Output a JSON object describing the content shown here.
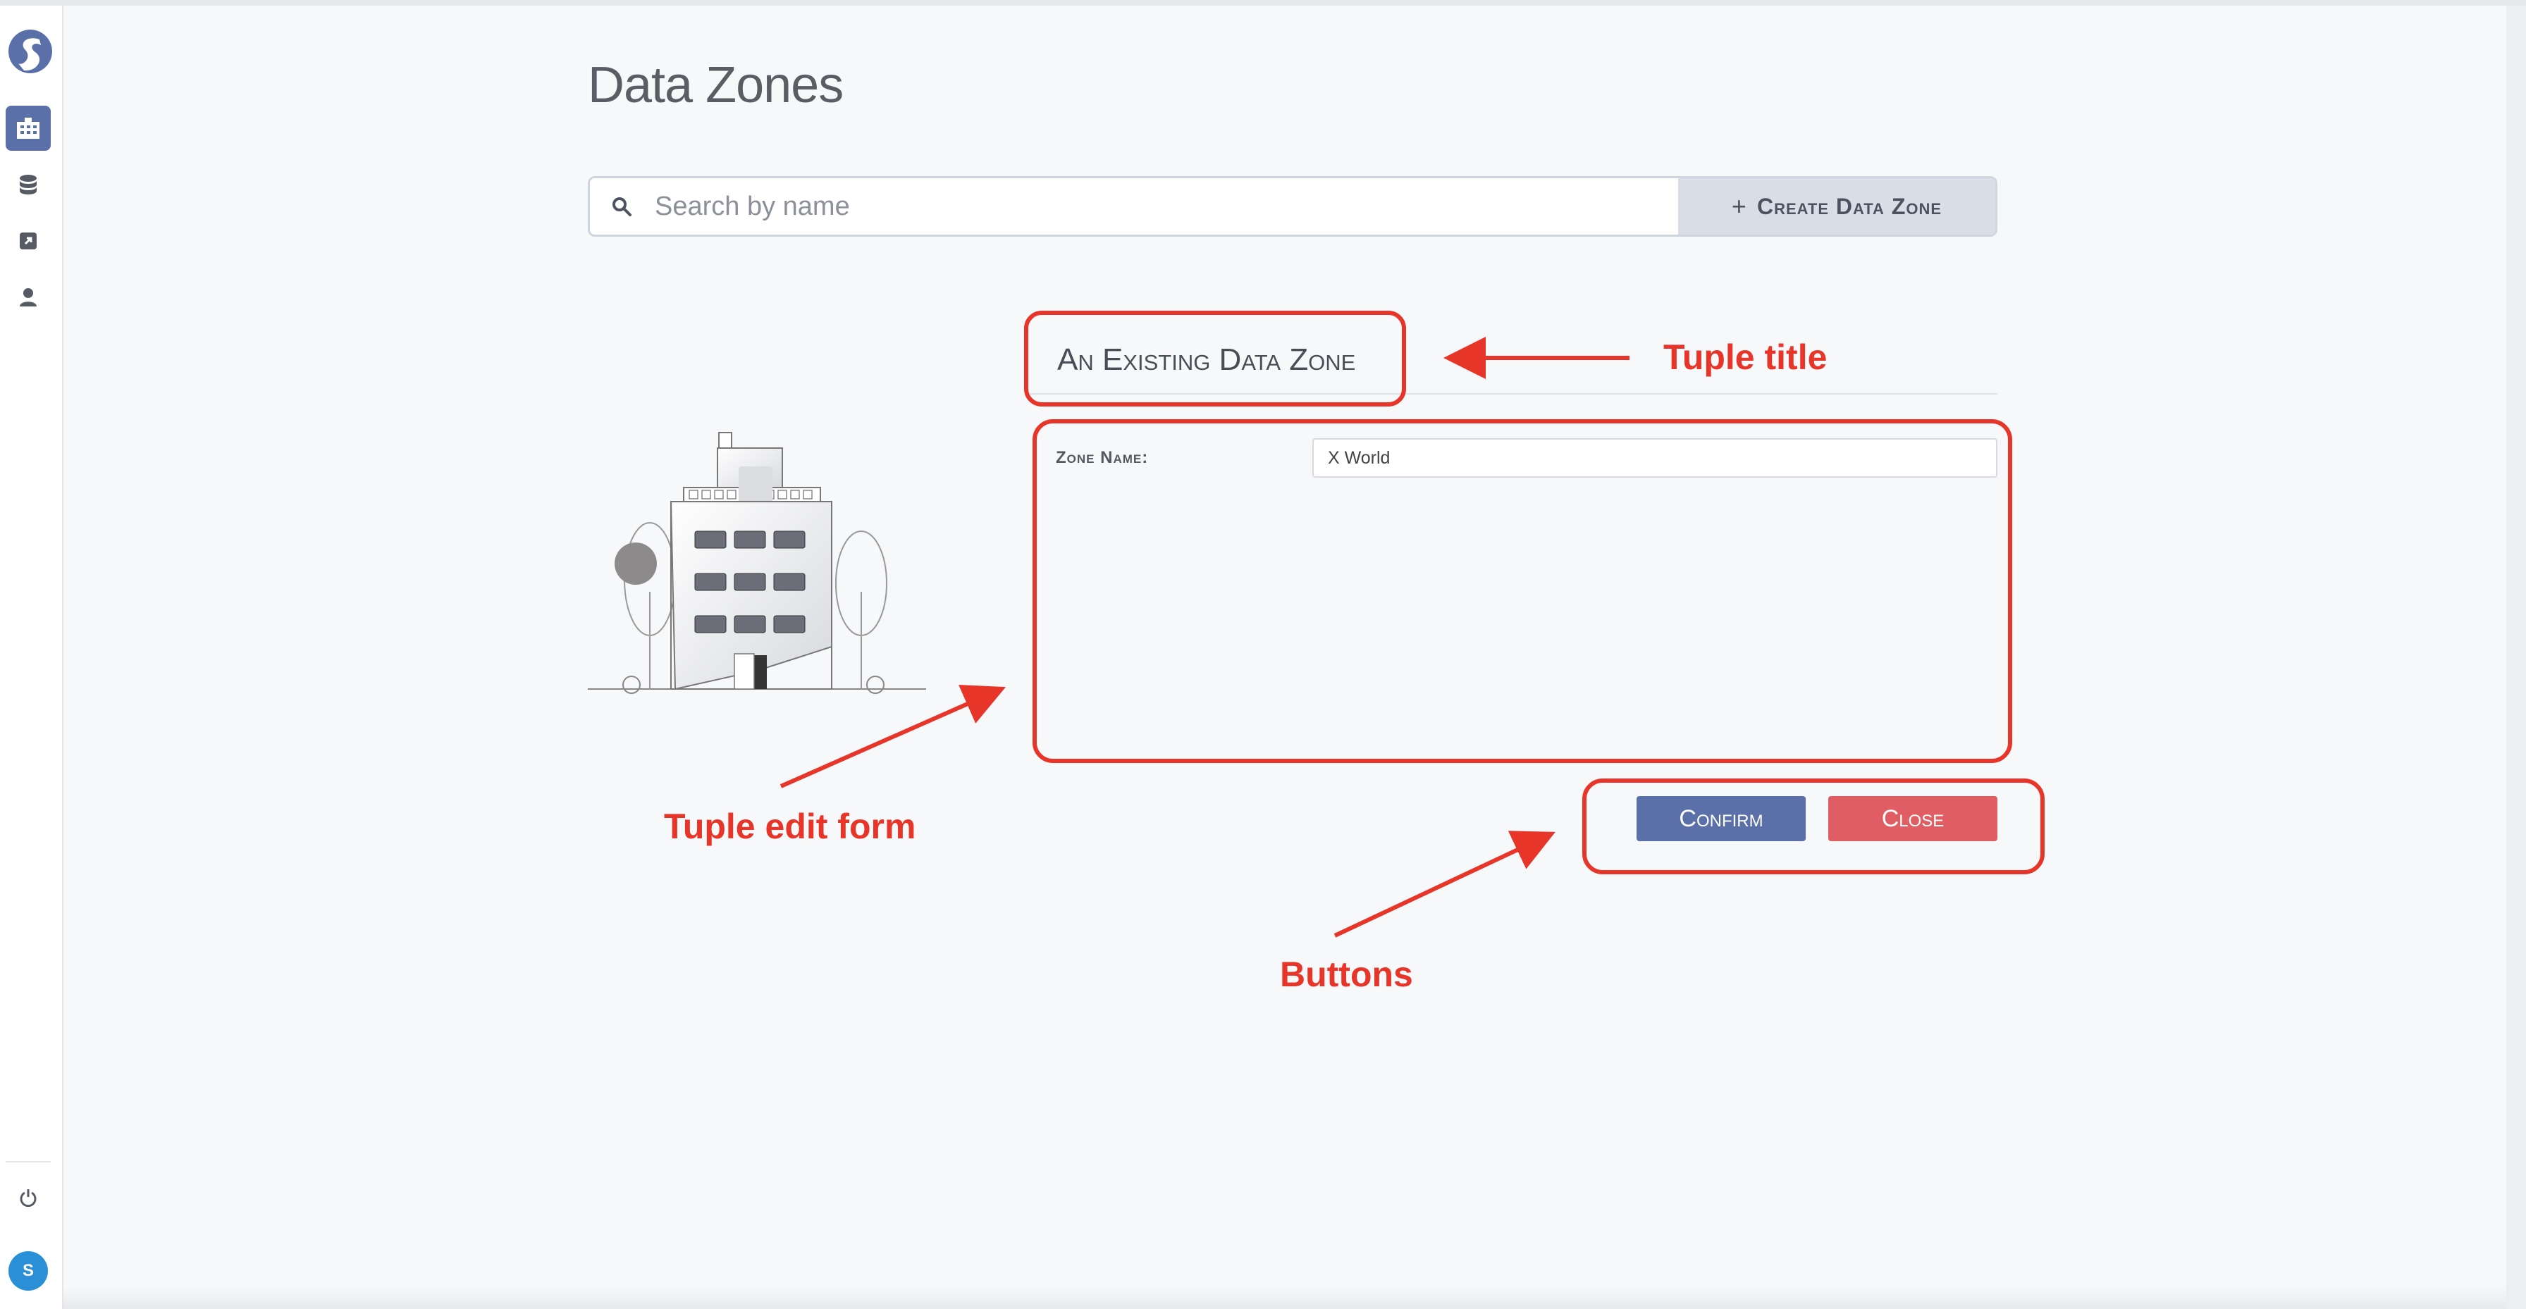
{
  "page": {
    "title": "Data Zones"
  },
  "search": {
    "placeholder": "Search by name",
    "value": ""
  },
  "create_button": {
    "icon": "plus-icon",
    "label": "Create Data Zone"
  },
  "sidebar": {
    "items": [
      {
        "icon": "building-icon",
        "active": true
      },
      {
        "icon": "database-icon",
        "active": false
      },
      {
        "icon": "external-link-icon",
        "active": false
      },
      {
        "icon": "user-icon",
        "active": false
      }
    ],
    "logout_icon": "power-icon",
    "avatar_initials": "S"
  },
  "tuple": {
    "title": "An Existing Data Zone",
    "fields": [
      {
        "label": "Zone Name:",
        "value": "X World"
      }
    ]
  },
  "buttons": {
    "confirm": "Confirm",
    "close": "Close"
  },
  "annotations": {
    "tuple_title": "Tuple title",
    "tuple_edit_form": "Tuple edit form",
    "buttons": "Buttons"
  },
  "colors": {
    "accent": "#5b6fa8",
    "danger": "#e05d63",
    "annotation": "#e8352a",
    "avatar": "#2a8fd6"
  }
}
